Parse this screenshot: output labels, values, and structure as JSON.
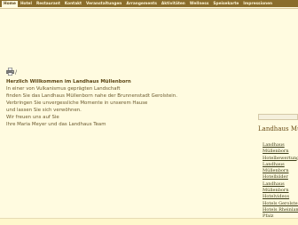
{
  "nav": {
    "items": [
      "Home",
      "Hotel",
      "Restaurant",
      "Kontakt",
      "Veranstaltungen",
      "Arrangements",
      "Aktivitäten",
      "Wellness",
      "Speisekarte",
      "Impressionen"
    ]
  },
  "toolbar": {
    "separator": "/"
  },
  "content": {
    "heading": "Herzlich Willkommen im Landhaus Müllenborn",
    "lines": [
      "In einer von Vulkanismus geprägten Landschaft",
      "finden Sie das Landhaus Müllenborn nahe der Brunnenstadt Gerolstein.",
      "Verbringen Sie unvergessliche Momente in unserem Hause",
      "und lassen Sie sich verwöhnen.",
      "Wir freuen uns auf Sie",
      "Ihre Maria Meyer und das Landhaus Team"
    ]
  },
  "sidebar": {
    "title": "Landhaus Müllenborn",
    "links": [
      "Landhaus",
      "Müllenborn",
      "Hotelbewertung",
      "Landhaus",
      "Müllenborn",
      "Hotelbilder",
      "Landhaus",
      "Müllenborn",
      "Hotelvideos",
      "Hotels Gerolstein",
      "Hotels Rheinland-",
      "Pfalz"
    ]
  }
}
